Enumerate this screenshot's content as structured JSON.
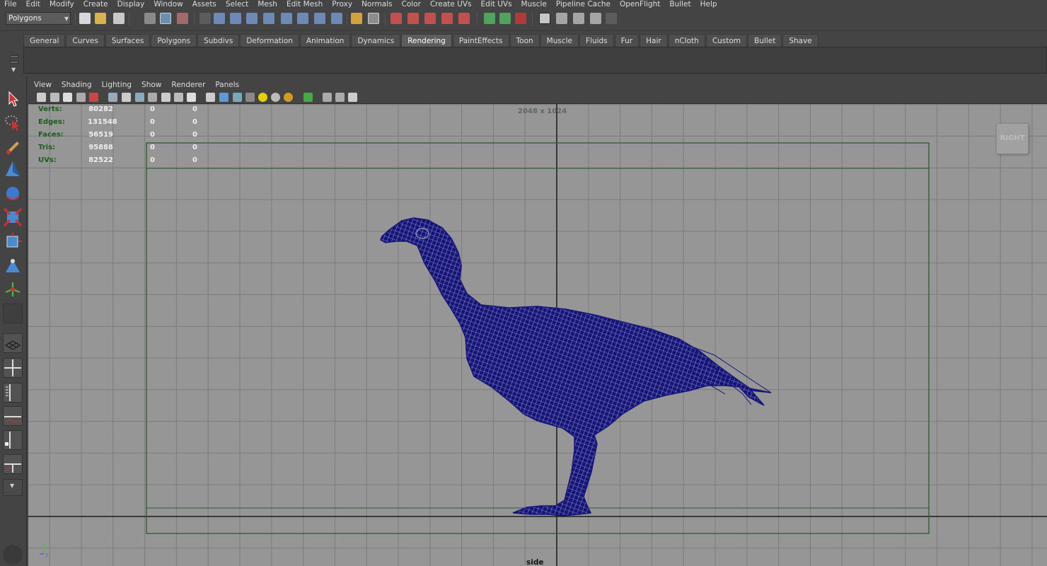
{
  "menubar": {
    "items": [
      "File",
      "Edit",
      "Modify",
      "Create",
      "Display",
      "Window",
      "Assets",
      "Select",
      "Mesh",
      "Edit Mesh",
      "Proxy",
      "Normals",
      "Color",
      "Create UVs",
      "Edit UVs",
      "Muscle",
      "Pipeline Cache",
      "OpenFlight",
      "Bullet",
      "Help"
    ]
  },
  "statusline": {
    "mode": "Polygons"
  },
  "shelf": {
    "tabs": [
      "General",
      "Curves",
      "Surfaces",
      "Polygons",
      "Subdivs",
      "Deformation",
      "Animation",
      "Dynamics",
      "Rendering",
      "PaintEffects",
      "Toon",
      "Muscle",
      "Fluids",
      "Fur",
      "Hair",
      "nCloth",
      "Custom",
      "Bullet",
      "Shave"
    ],
    "active_tab": "Rendering"
  },
  "panel": {
    "menu": [
      "View",
      "Shading",
      "Lighting",
      "Show",
      "Renderer",
      "Panels"
    ]
  },
  "hud": {
    "rows": [
      {
        "label": "Verts:",
        "v1": "80282",
        "v2": "0",
        "v3": "0"
      },
      {
        "label": "Edges:",
        "v1": "131548",
        "v2": "0",
        "v3": "0"
      },
      {
        "label": "Faces:",
        "v1": "56519",
        "v2": "0",
        "v3": "0"
      },
      {
        "label": "Tris:",
        "v1": "95888",
        "v2": "0",
        "v3": "0"
      },
      {
        "label": "UVs:",
        "v1": "82522",
        "v2": "0",
        "v3": "0"
      }
    ]
  },
  "viewport": {
    "resolution": "2048 x 1024",
    "view_cube": "RIGHT",
    "camera": "side",
    "axis_y": "y",
    "axis_z": "z",
    "background_color": "#969696",
    "wireframe_color": "#14147a",
    "resolution_gate_color": "#2d5a2d"
  }
}
